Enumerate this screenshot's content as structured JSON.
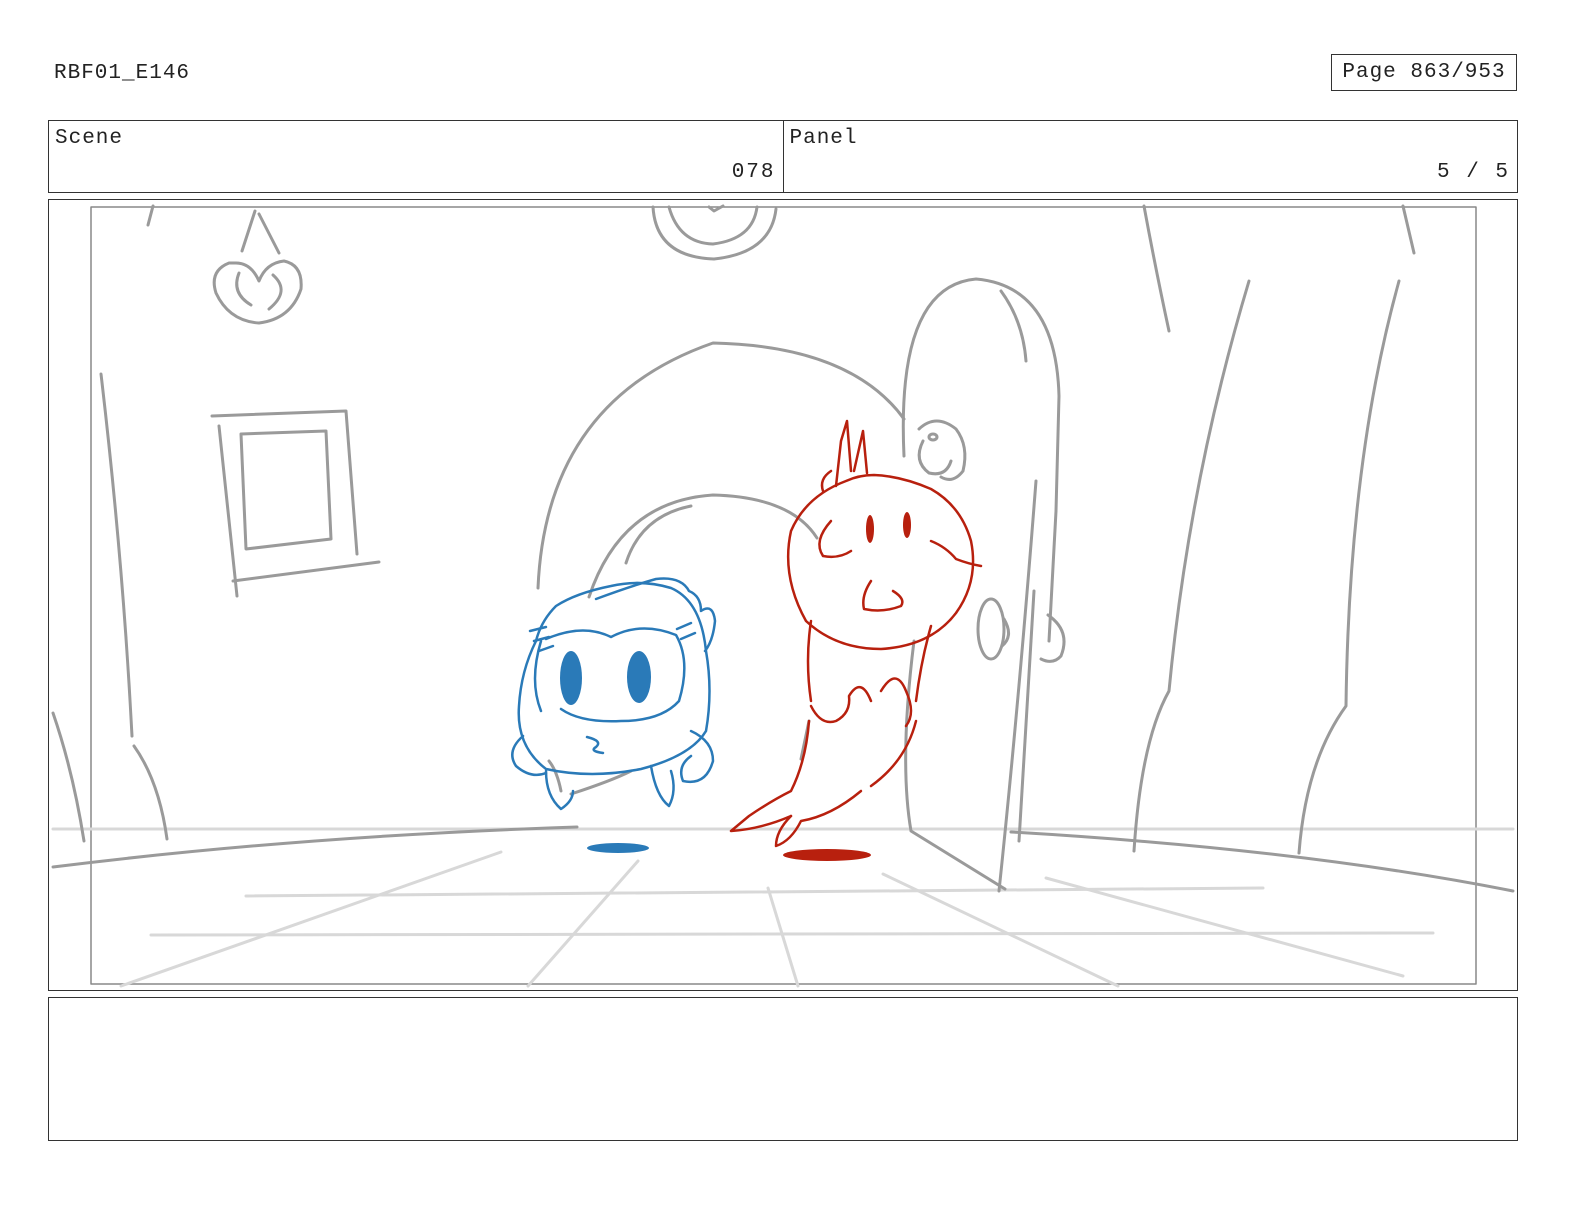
{
  "header": {
    "document_id": "RBF01_E146",
    "page_label": "Page 863/953"
  },
  "info": {
    "scene_label": "Scene",
    "scene_value": "078",
    "panel_label": "Panel",
    "panel_value": "5 / 5"
  },
  "panel": {
    "description": "Storyboard sketch: a blue round character and a red character emerge through an arched doorway into a tiled room",
    "colors": {
      "blue_character": "#2a7ab8",
      "red_character": "#b8200e",
      "background_lines": "#9a9a9a"
    }
  },
  "notes": {
    "text": ""
  }
}
